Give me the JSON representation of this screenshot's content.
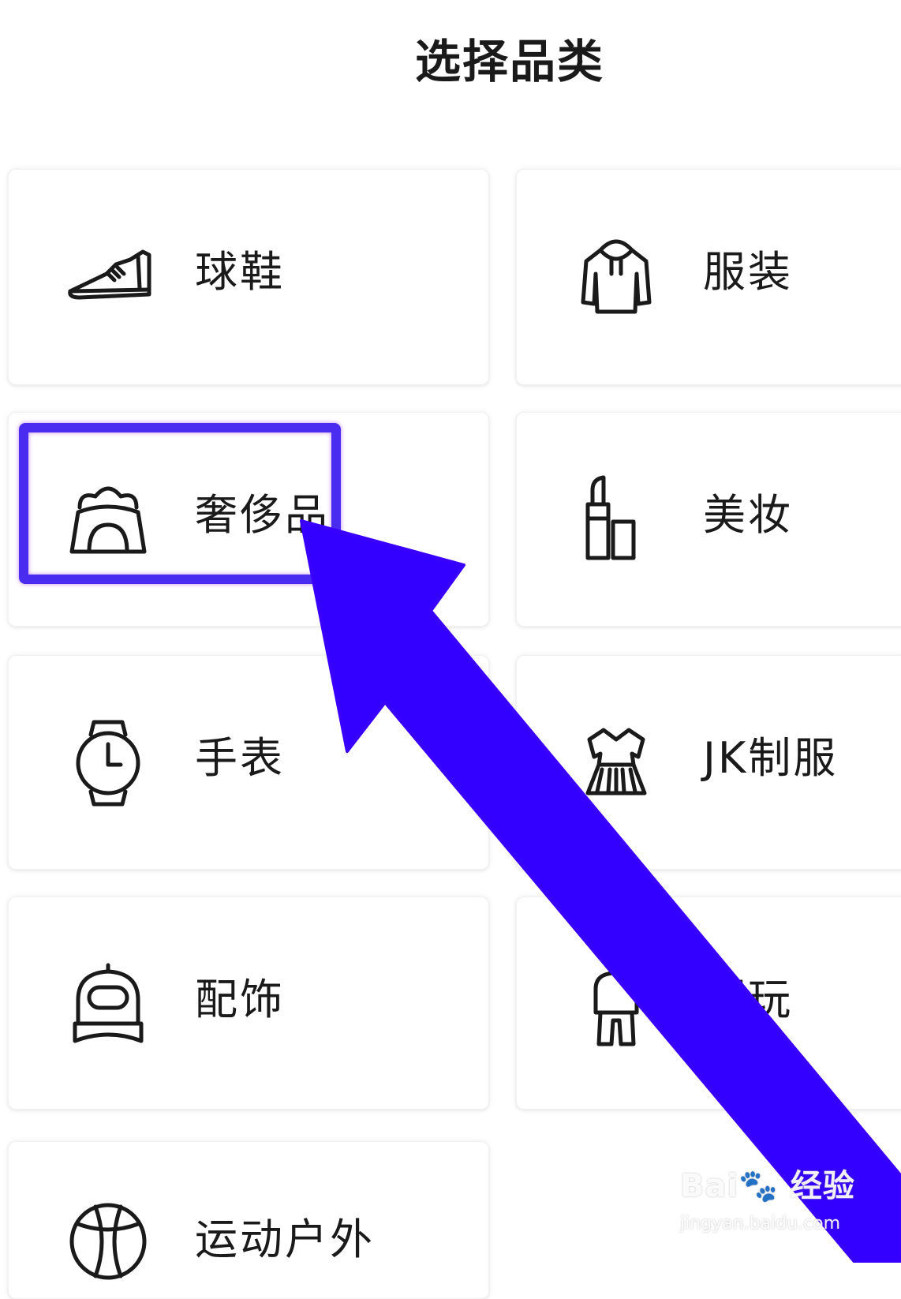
{
  "page": {
    "title": "选择品类"
  },
  "categories": [
    {
      "label": "球鞋",
      "icon": "sneaker-icon"
    },
    {
      "label": "服装",
      "icon": "hoodie-icon"
    },
    {
      "label": "奢侈品",
      "icon": "handbag-icon",
      "highlighted": true
    },
    {
      "label": "美妆",
      "icon": "lipstick-icon"
    },
    {
      "label": "手表",
      "icon": "watch-icon"
    },
    {
      "label": "JK制服",
      "icon": "dress-icon"
    },
    {
      "label": "配饰",
      "icon": "cap-icon"
    },
    {
      "label": "潮玩",
      "icon": "toy-icon"
    },
    {
      "label": "运动户外",
      "icon": "ball-icon"
    }
  ],
  "annotation": {
    "highlight_color": "#4a2cf0",
    "arrow_color": "#3300ff"
  },
  "watermark": {
    "brand": "Bai🐾 经验",
    "url": "jingyan.baidu.com"
  }
}
